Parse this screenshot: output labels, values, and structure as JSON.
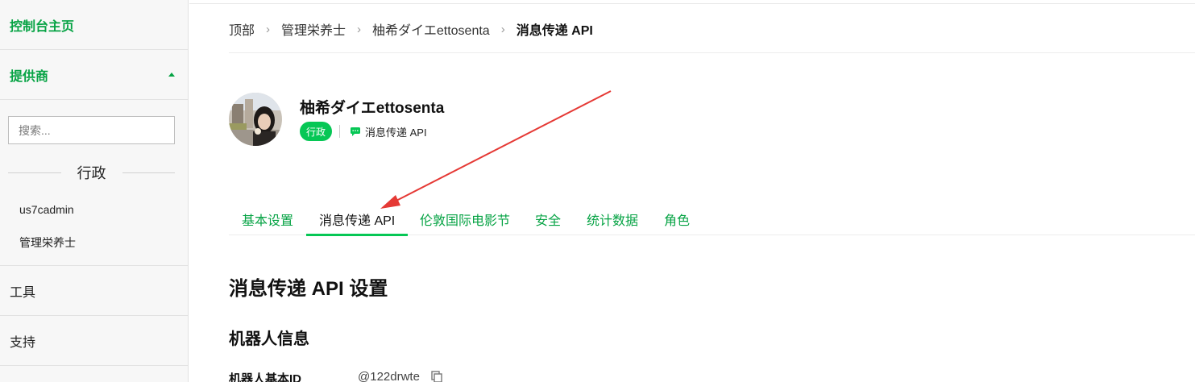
{
  "sidebar": {
    "console_home": "控制台主页",
    "provider": "提供商",
    "search_placeholder": "搜索...",
    "section_title": "行政",
    "items": [
      {
        "label": "us7cadmin"
      },
      {
        "label": "管理栄养士"
      }
    ],
    "tools": "工具",
    "support": "支持"
  },
  "breadcrumb": {
    "items": [
      "顶部",
      "管理栄养士",
      "柚希ダイエettosenta",
      "消息传递 API"
    ]
  },
  "profile": {
    "name": "柚希ダイエettosenta",
    "badge": "行政",
    "channel_type": "消息传递 API"
  },
  "tabs": [
    {
      "label": "基本设置",
      "active": false
    },
    {
      "label": "消息传递 API",
      "active": true
    },
    {
      "label": "伦敦国际电影节",
      "active": false
    },
    {
      "label": "安全",
      "active": false
    },
    {
      "label": "统计数据",
      "active": false
    },
    {
      "label": "角色",
      "active": false
    }
  ],
  "content": {
    "section_title": "消息传递 API 设置",
    "bot_info_title": "机器人信息",
    "bot_basic_id_label": "机器人基本ID",
    "bot_basic_id_value": "@122drwte"
  },
  "colors": {
    "accent": "#06c755",
    "link_green": "#06a344",
    "annotation_arrow": "#e53935"
  },
  "icons": {
    "chat": "chat-bubble-icon",
    "copy": "copy-icon",
    "caret": "caret-up-icon"
  }
}
